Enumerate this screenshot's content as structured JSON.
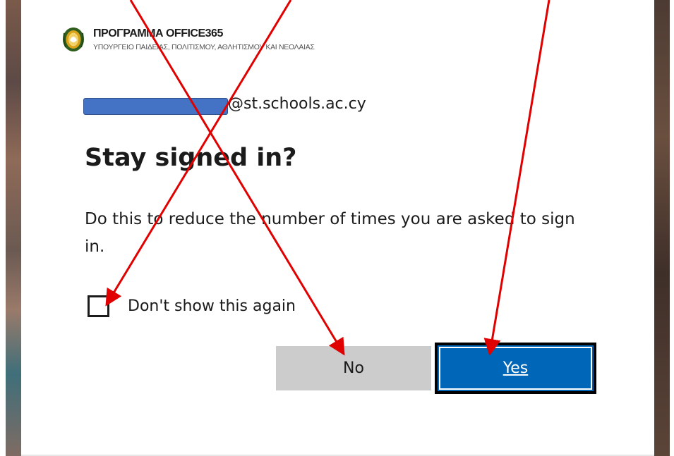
{
  "org": {
    "title": "ΠΡΟΓΡΑΜΜΑ OFFICE365",
    "subtitle": "ΥΠΟΥΡΓΕΙΟ ΠΑΙΔΕΙΑΣ, ΠΟΛΙΤΙΣΜΟΥ, ΑΘΛΗΤΙΣΜΟΥ ΚΑΙ ΝΕΟΛΑΙΑΣ",
    "emblem_icon": "cyprus-emblem-icon"
  },
  "account": {
    "domain": "@st.schools.ac.cy",
    "redaction_color": "#4472c4"
  },
  "prompt": {
    "title": "Stay signed in?",
    "description": "Do this to reduce the number of times you are asked to sign in."
  },
  "checkbox": {
    "label": "Don't show this again",
    "checked": false
  },
  "buttons": {
    "no_label": "No",
    "yes_label": "Yes"
  },
  "colors": {
    "primary": "#0067b8",
    "secondary": "#cccccc",
    "annotation": "#e00000"
  }
}
